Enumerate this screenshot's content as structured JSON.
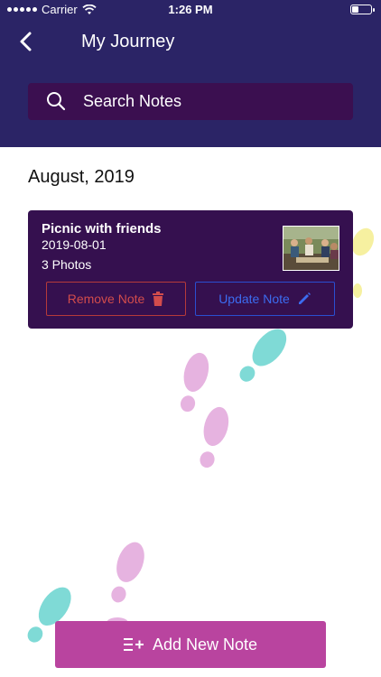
{
  "status_bar": {
    "carrier": "Carrier",
    "time": "1:26 PM"
  },
  "nav": {
    "title": "My Journey"
  },
  "search": {
    "placeholder": "Search Notes"
  },
  "section": {
    "date": "August, 2019"
  },
  "notes": [
    {
      "title": "Picnic with friends",
      "date": "2019-08-01",
      "photos": "3 Photos",
      "remove_label": "Remove Note",
      "update_label": "Update Note"
    }
  ],
  "footer": {
    "add_label": "Add New Note"
  },
  "colors": {
    "header_bg": "#2b2466",
    "search_bg": "#3b0f50",
    "card_bg": "#35104f",
    "remove": "#d24c4c",
    "update": "#3c6cf0",
    "add_button": "#b9449f",
    "footprint_pink": "#e6b3e0",
    "footprint_teal": "#7fdad6",
    "footprint_yellow": "#f6f0a0"
  },
  "icons": [
    "back-chevron-icon",
    "search-icon",
    "trash-icon",
    "pencil-icon",
    "list-add-icon",
    "wifi-icon",
    "battery-icon"
  ]
}
